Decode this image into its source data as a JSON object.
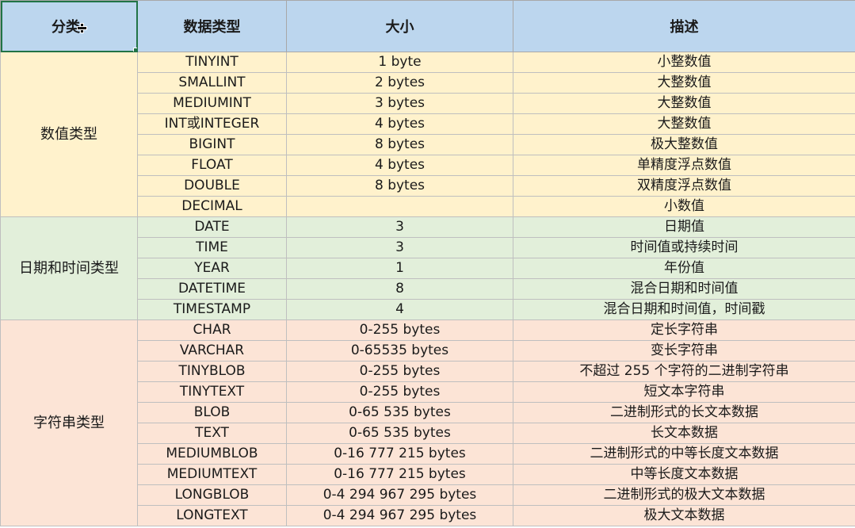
{
  "headers": [
    "分类",
    "数据类型",
    "大小",
    "描述"
  ],
  "groups": [
    {
      "category": "数值类型",
      "style": "num",
      "rows": [
        [
          "TINYINT",
          "1 byte",
          "小整数值"
        ],
        [
          "SMALLINT",
          "2 bytes",
          "大整数值"
        ],
        [
          "MEDIUMINT",
          "3 bytes",
          "大整数值"
        ],
        [
          "INT或INTEGER",
          "4 bytes",
          "大整数值"
        ],
        [
          "BIGINT",
          "8 bytes",
          "极大整数值"
        ],
        [
          "FLOAT",
          "4 bytes",
          "单精度浮点数值"
        ],
        [
          "DOUBLE",
          "8 bytes",
          "双精度浮点数值"
        ],
        [
          "DECIMAL",
          "",
          "小数值"
        ]
      ]
    },
    {
      "category": "日期和时间类型",
      "style": "date",
      "rows": [
        [
          "DATE",
          "3",
          "日期值"
        ],
        [
          "TIME",
          "3",
          "时间值或持续时间"
        ],
        [
          "YEAR",
          "1",
          "年份值"
        ],
        [
          "DATETIME",
          "8",
          "混合日期和时间值"
        ],
        [
          "TIMESTAMP",
          "4",
          "混合日期和时间值，时间戳"
        ]
      ]
    },
    {
      "category": "字符串类型",
      "style": "str",
      "rows": [
        [
          "CHAR",
          "0-255 bytes",
          "定长字符串"
        ],
        [
          "VARCHAR",
          "0-65535 bytes",
          "变长字符串"
        ],
        [
          "TINYBLOB",
          "0-255 bytes",
          "不超过 255 个字符的二进制字符串"
        ],
        [
          "TINYTEXT",
          "0-255 bytes",
          "短文本字符串"
        ],
        [
          "BLOB",
          "0-65 535 bytes",
          "二进制形式的长文本数据"
        ],
        [
          "TEXT",
          "0-65 535 bytes",
          "长文本数据"
        ],
        [
          "MEDIUMBLOB",
          "0-16 777 215 bytes",
          "二进制形式的中等长度文本数据"
        ],
        [
          "MEDIUMTEXT",
          "0-16 777 215 bytes",
          "中等长度文本数据"
        ],
        [
          "LONGBLOB",
          "0-4 294 967 295 bytes",
          "二进制形式的极大文本数据"
        ],
        [
          "LONGTEXT",
          "0-4 294 967 295 bytes",
          "极大文本数据"
        ]
      ]
    }
  ]
}
